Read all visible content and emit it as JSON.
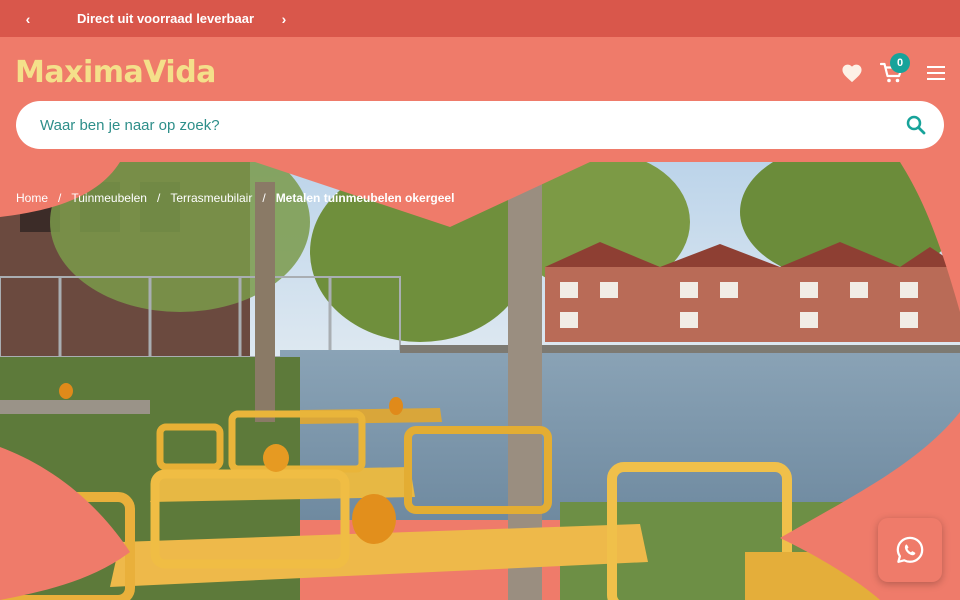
{
  "topbar": {
    "promo": "Direct uit voorraad leverbaar",
    "prev_icon": "chevron-left-icon",
    "next_icon": "chevron-right-icon"
  },
  "header": {
    "logo": "MaximaVida",
    "cart_count": "0",
    "icons": [
      "heart-icon",
      "cart-icon",
      "menu-icon"
    ]
  },
  "search": {
    "placeholder": "Waar ben je naar op zoek?",
    "value": ""
  },
  "breadcrumb": {
    "items": [
      "Home",
      "Tuinmeubelen",
      "Terrasmeubilair"
    ],
    "current": "Metalen tuinmeubelen okergeel",
    "separator": "/"
  },
  "colors": {
    "brand": "#ef7b6a",
    "topbar": "#d9574b",
    "logo": "#f4e08a",
    "accent": "#17a39a"
  },
  "floating": {
    "icon": "whatsapp-icon"
  }
}
